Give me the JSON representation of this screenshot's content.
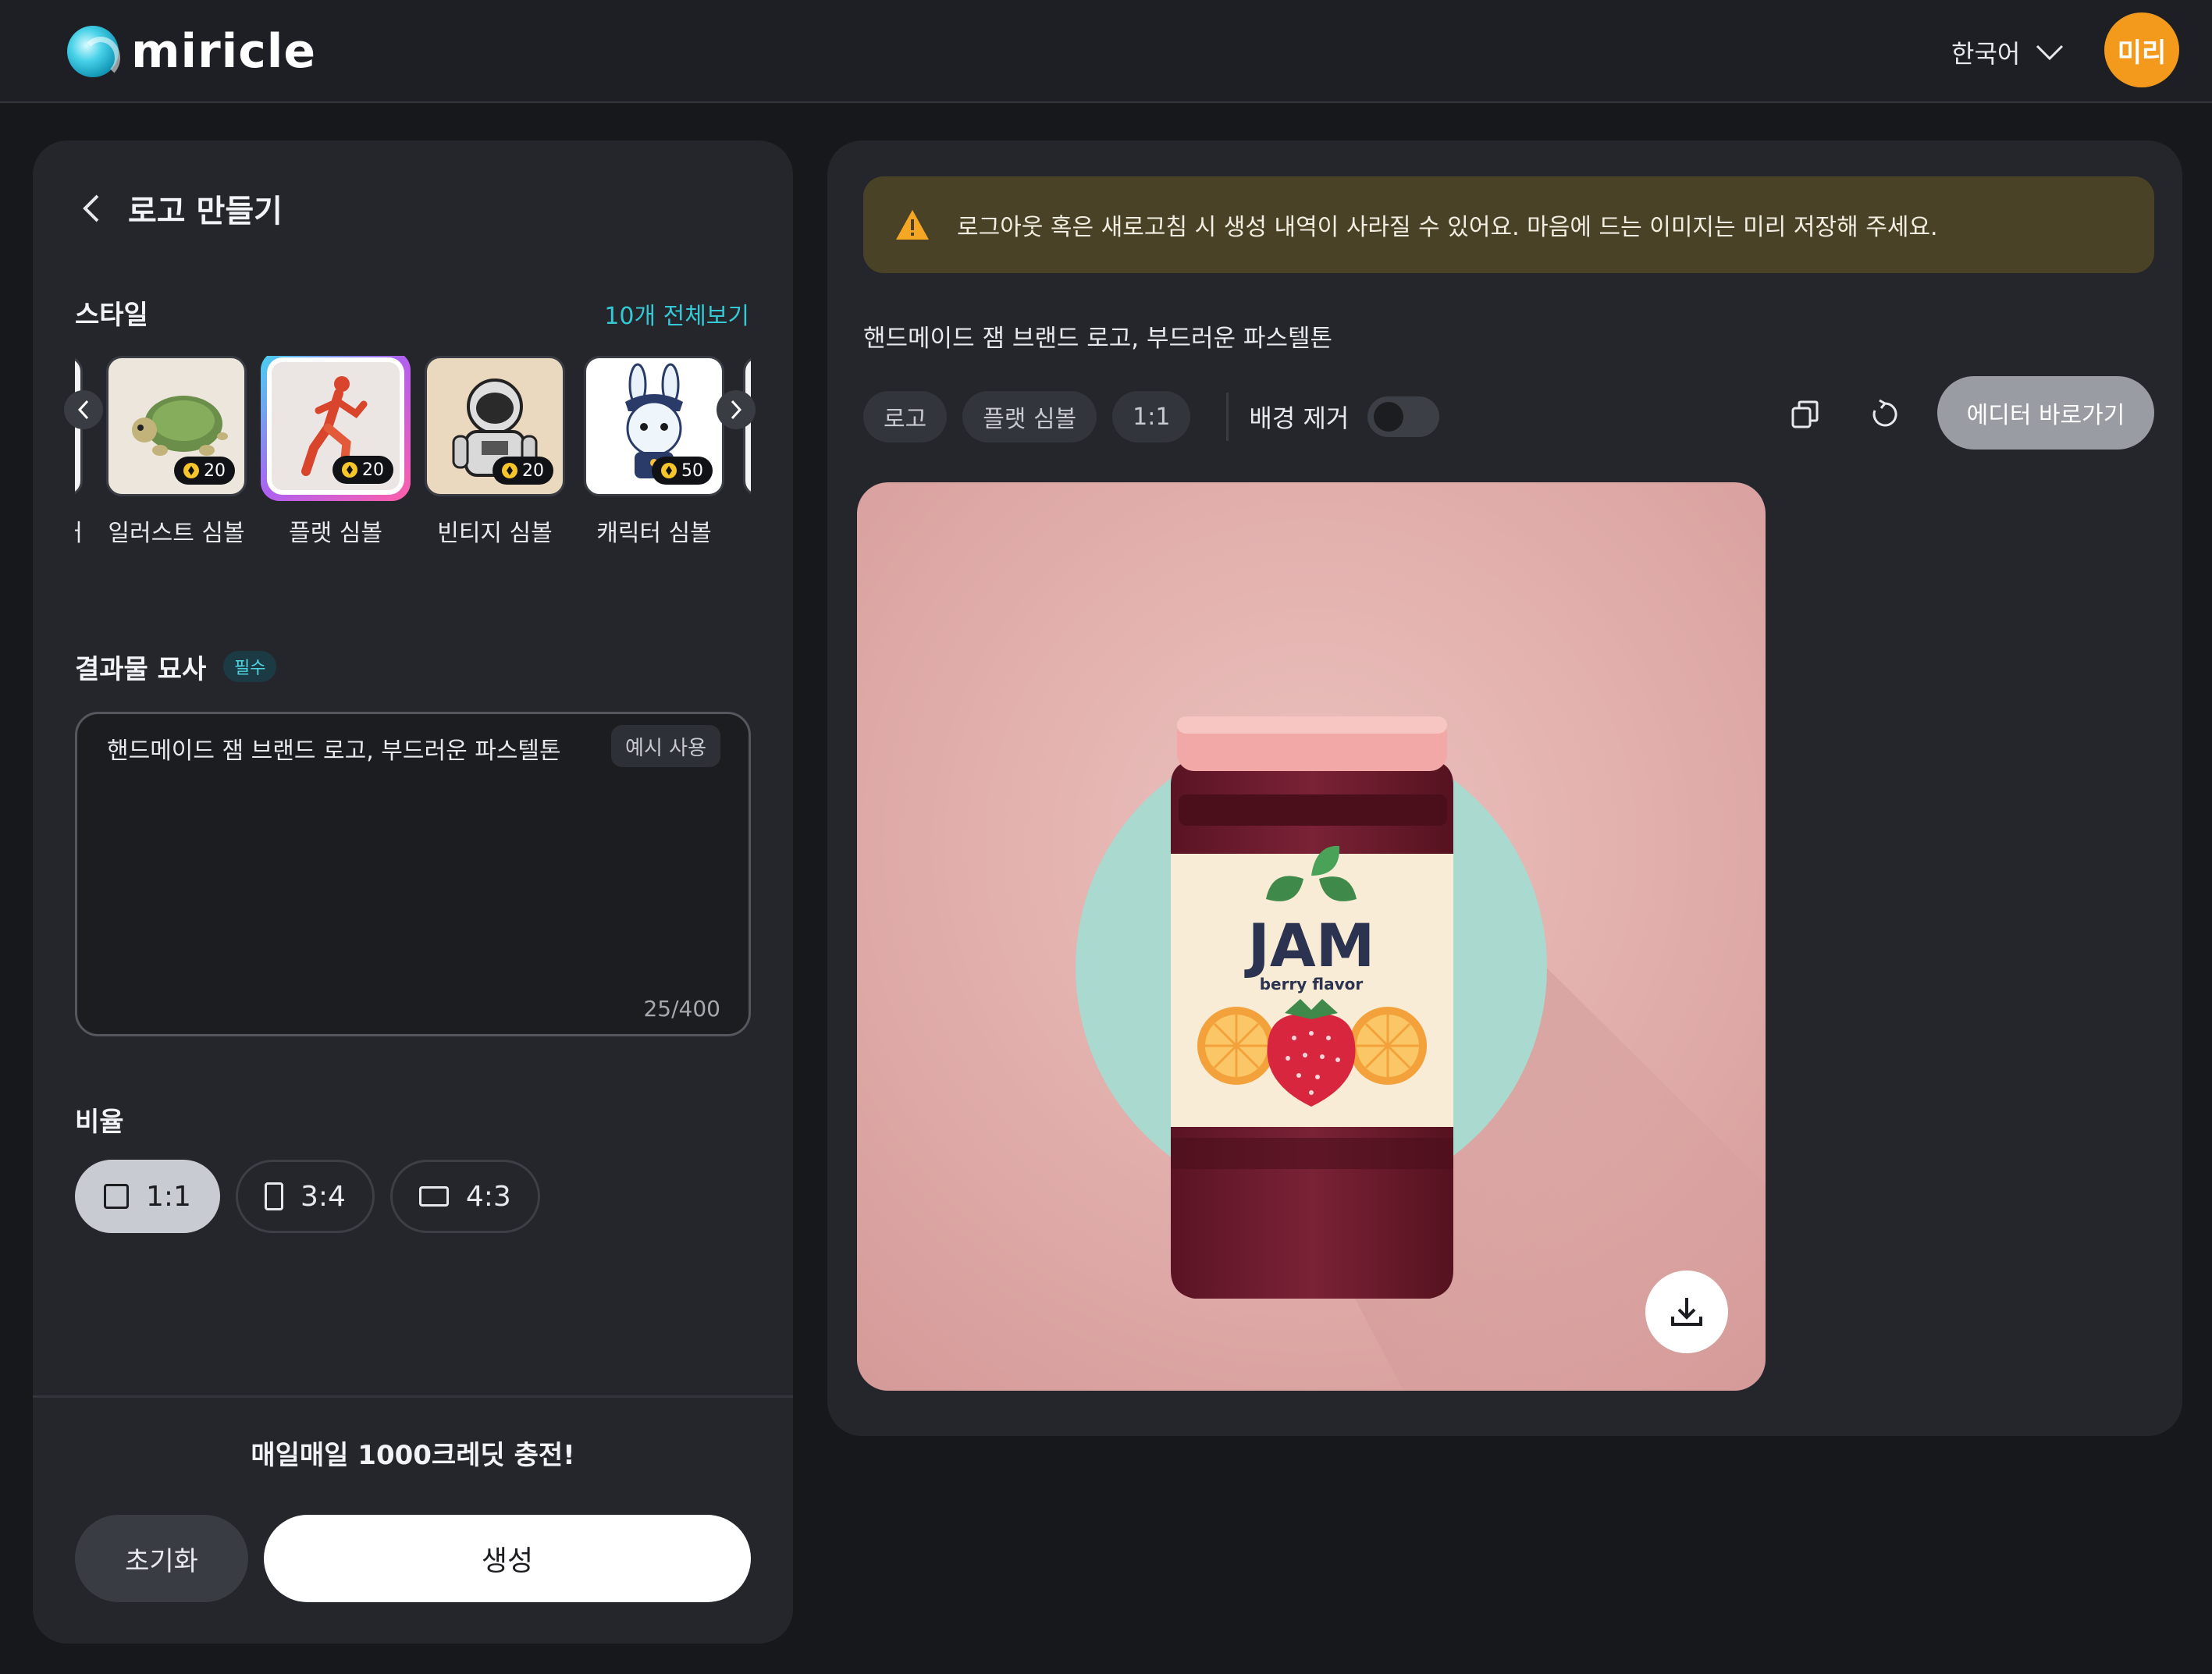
{
  "header": {
    "brand": "miricle",
    "language": "한국어",
    "avatar_text": "미리"
  },
  "left": {
    "title": "로고 만들기",
    "style_section": {
      "label": "스타일",
      "see_all": "10개 전체보기",
      "partial_left_label": "터",
      "items": [
        {
          "name": "일러스트 심볼",
          "credits": "20",
          "selected": false,
          "icon": "turtle-illustration"
        },
        {
          "name": "플랫 심볼",
          "credits": "20",
          "selected": true,
          "icon": "runner-flat"
        },
        {
          "name": "빈티지 심볼",
          "credits": "20",
          "selected": false,
          "icon": "astronaut-vintage"
        },
        {
          "name": "캐릭터 심볼",
          "credits": "50",
          "selected": false,
          "icon": "bunny-police-character"
        }
      ]
    },
    "description": {
      "label": "결과물 묘사",
      "required_badge": "필수",
      "value": "핸드메이드 잼 브랜드 로고, 부드러운 파스텔톤",
      "example_button": "예시 사용",
      "counter": "25/400"
    },
    "ratio": {
      "label": "비율",
      "options": [
        {
          "label": "1:1",
          "active": true
        },
        {
          "label": "3:4",
          "active": false
        },
        {
          "label": "4:3",
          "active": false
        }
      ]
    },
    "footer": {
      "promo": "매일매일 1000크레딧 충전!",
      "reset": "초기화",
      "generate": "생성"
    }
  },
  "right": {
    "notice": "로그아웃 혹은 새로고침 시 생성 내역이 사라질 수 있어요. 마음에 드는 이미지는 미리 저장해 주세요.",
    "prompt": "핸드메이드 잼 브랜드 로고, 부드러운 파스텔톤",
    "tags": [
      "로고",
      "플랫 심볼",
      "1:1"
    ],
    "bg_remove_label": "배경 제거",
    "bg_remove_on": false,
    "editor_button": "에디터 바로가기",
    "image": {
      "jar_title": "JAM",
      "jar_subtitle": "berry flavor"
    }
  },
  "colors": {
    "accent": "#35c9d5",
    "avatar": "#f39a1c",
    "notice_bg": "#4a4226",
    "panel_bg": "#24262c"
  }
}
